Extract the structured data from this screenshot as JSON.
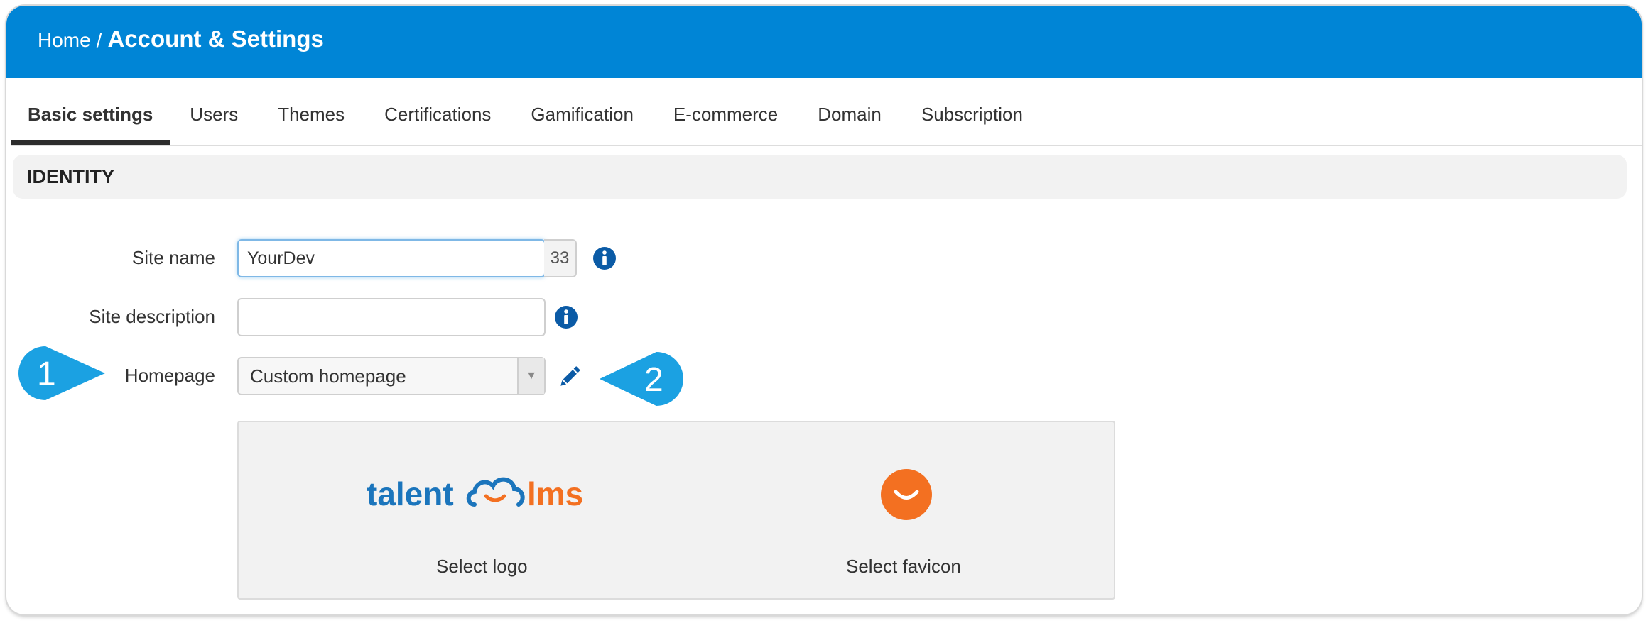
{
  "breadcrumb": {
    "home": "Home",
    "separator": "/",
    "current": "Account & Settings"
  },
  "tabs": [
    {
      "label": "Basic settings",
      "active": true
    },
    {
      "label": "Users"
    },
    {
      "label": "Themes"
    },
    {
      "label": "Certifications"
    },
    {
      "label": "Gamification"
    },
    {
      "label": "E-commerce"
    },
    {
      "label": "Domain"
    },
    {
      "label": "Subscription"
    }
  ],
  "section": {
    "title": "IDENTITY"
  },
  "form": {
    "site_name": {
      "label": "Site name",
      "value": "YourDev",
      "counter": "33"
    },
    "site_description": {
      "label": "Site description",
      "value": ""
    },
    "homepage": {
      "label": "Homepage",
      "selected": "Custom homepage"
    }
  },
  "media": {
    "logo": {
      "brand_left": "talent",
      "brand_right": "lms",
      "caption": "Select logo"
    },
    "favicon": {
      "caption": "Select favicon"
    }
  },
  "callouts": {
    "one": "1",
    "two": "2"
  },
  "colors": {
    "header": "#0085d6",
    "brand_blue": "#1b75bc",
    "brand_orange": "#f37021",
    "callout": "#1ba1e2",
    "icon_blue": "#0b5ba6"
  },
  "icons": {
    "info": "info-icon",
    "edit": "pencil-icon",
    "dropdown": "caret-down-icon"
  }
}
